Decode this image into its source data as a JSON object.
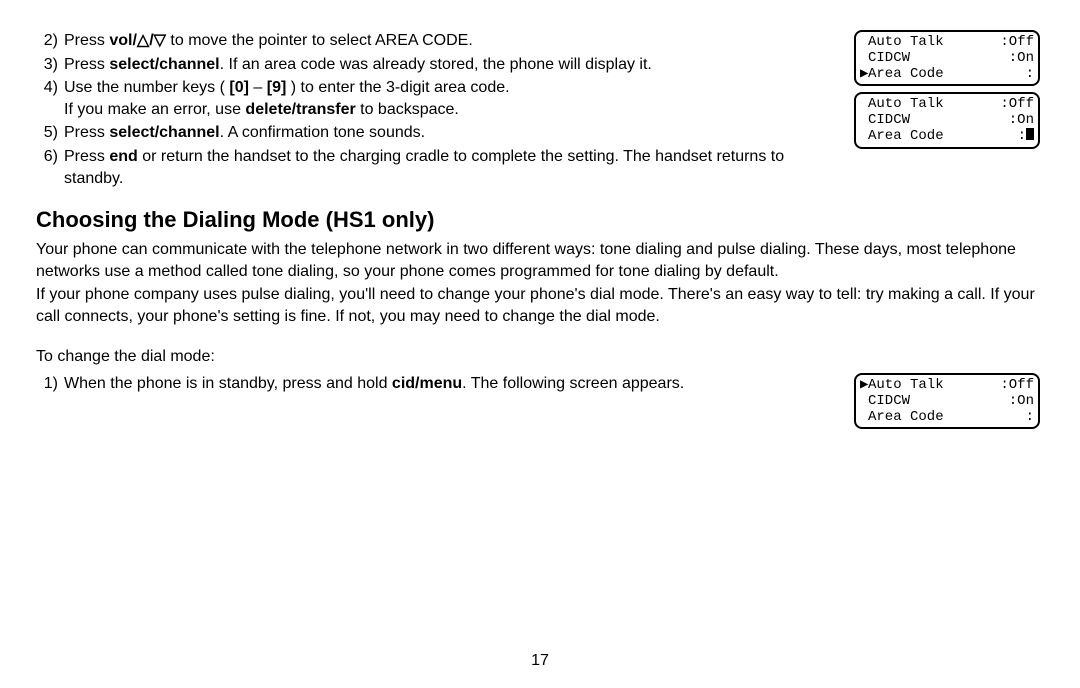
{
  "steps_top": [
    {
      "num": "2)",
      "pre": "Press ",
      "bold": "vol/△/▽",
      "post": " to move the pointer to select AREA CODE."
    },
    {
      "num": "3)",
      "pre": "Press ",
      "bold": "select/channel",
      "post": ". If an area code was already stored, the phone will display it."
    },
    {
      "num": "4)",
      "pre": "Use the number keys ( ",
      "bold": "[0]",
      "mid": " – ",
      "bold2": "[9]",
      "post": " ) to enter the 3-digit area code.",
      "line2_pre": "If you make an error, use ",
      "line2_bold": "delete/transfer",
      "line2_post": " to backspace."
    },
    {
      "num": "5)",
      "pre": "Press ",
      "bold": "select/channel",
      "post": ". A confirmation tone sounds."
    },
    {
      "num": "6)",
      "pre": "Press ",
      "bold": "end",
      "post": " or return the handset to the charging cradle to complete the setting. The handset returns to standby."
    }
  ],
  "heading": "Choosing the Dialing Mode (HS1 only)",
  "para1": "Your phone can communicate with the telephone network in two different ways: tone dialing and pulse dialing. These days, most telephone networks use a method called tone dialing, so your phone comes programmed for tone dialing by default.",
  "para2": "If your phone company uses pulse dialing, you'll need to change your phone's dial mode. There's an easy way to tell: try making a call. If your call connects, your phone's setting is fine. If not, you may need to change the dial mode.",
  "para3": "To change the dial mode:",
  "step_bottom": {
    "num": "1)",
    "pre": "When the phone is in standby, press and hold ",
    "bold": "cid/menu",
    "post": ". The following screen appears."
  },
  "lcd1": {
    "r1": {
      "ptr": " ",
      "label": "Auto Talk",
      "val": ":Off"
    },
    "r2": {
      "ptr": " ",
      "label": "CIDCW",
      "val": ":On"
    },
    "r3": {
      "ptr": "▶",
      "label": "Area Code",
      "val": ":"
    }
  },
  "lcd2": {
    "r1": {
      "ptr": " ",
      "label": "Auto Talk",
      "val": ":Off"
    },
    "r2": {
      "ptr": " ",
      "label": "CIDCW",
      "val": ":On"
    },
    "r3": {
      "ptr": " ",
      "label": "Area Code",
      "val": ":",
      "cursor": true
    }
  },
  "lcd3": {
    "r1": {
      "ptr": "▶",
      "label": "Auto Talk",
      "val": ":Off"
    },
    "r2": {
      "ptr": " ",
      "label": "CIDCW",
      "val": ":On"
    },
    "r3": {
      "ptr": " ",
      "label": "Area Code",
      "val": ":"
    }
  },
  "pagenum": "17"
}
